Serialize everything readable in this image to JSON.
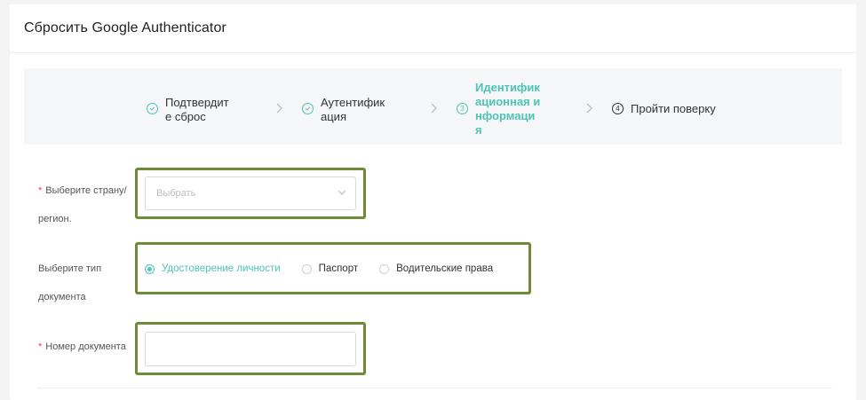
{
  "page": {
    "title": "Сбросить Google Authenticator"
  },
  "steps": [
    {
      "label_lines": [
        "Подтвердит",
        "е сброс"
      ],
      "status": "done",
      "icon": "check-circle-icon"
    },
    {
      "label_lines": [
        "Аутентифик",
        "ация"
      ],
      "status": "done",
      "icon": "check-circle-icon"
    },
    {
      "label_lines": [
        "Идентифик",
        "ационная и",
        "нформаци",
        "я"
      ],
      "number": "3",
      "status": "active"
    },
    {
      "label_lines": [
        "Пройти поверку"
      ],
      "number": "4",
      "status": "todo"
    }
  ],
  "form": {
    "country": {
      "required_mark": "*",
      "label_line1": "Выберите страну/",
      "label_line2": "регион.",
      "placeholder": "Выбрать"
    },
    "doc_type": {
      "label_line1": "Выберите тип",
      "label_line2": "документа",
      "options": [
        {
          "label": "Удостоверение личности",
          "checked": true
        },
        {
          "label": "Паспорт",
          "checked": false
        },
        {
          "label": "Водительские права",
          "checked": false
        }
      ]
    },
    "doc_number": {
      "required_mark": "*",
      "label": "Номер документа",
      "value": ""
    }
  },
  "colors": {
    "accent": "#4fc3b8",
    "highlight_border": "#6f8a36",
    "required": "#e5484d"
  }
}
